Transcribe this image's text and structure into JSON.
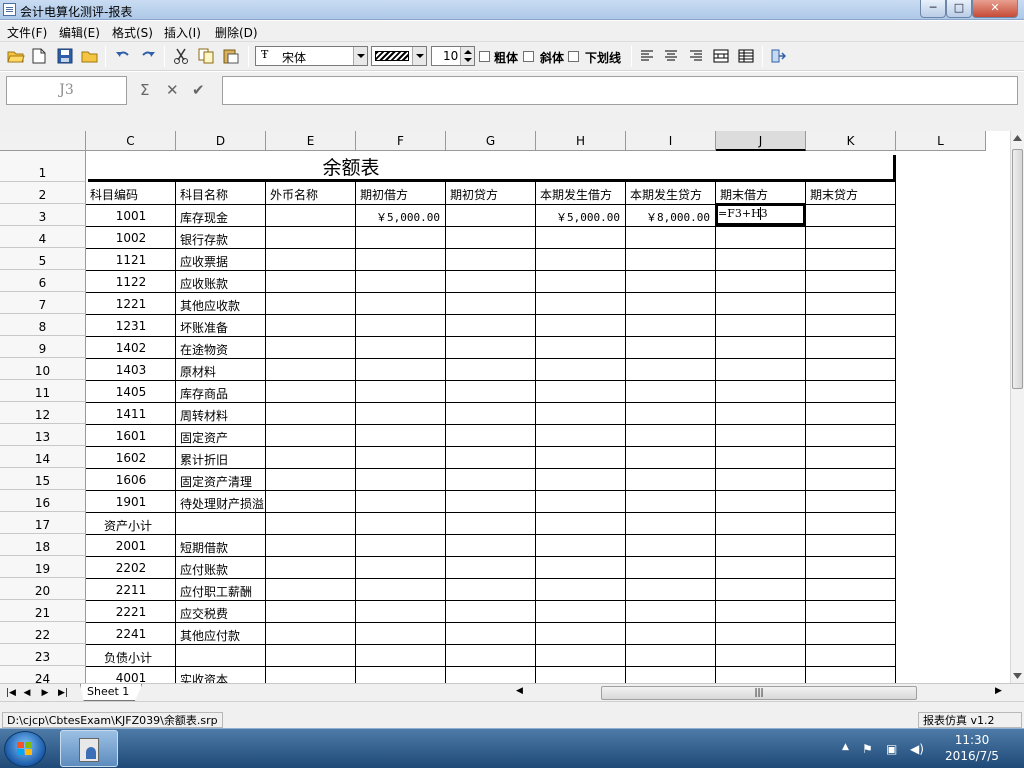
{
  "window": {
    "title": "会计电算化测评-报表",
    "min_label": "─",
    "max_label": "□",
    "close_label": "✕"
  },
  "menu": [
    "文件(F)",
    "编辑(E)",
    "格式(S)",
    "插入(I)",
    "删除(D)"
  ],
  "toolbar": {
    "font_name": "宋体",
    "font_size": "10",
    "bold_label": "粗体",
    "italic_label": "斜体",
    "underline_label": "下划线"
  },
  "formula_bar": {
    "cell_ref": "J3",
    "sum_symbol": "Σ",
    "cancel_symbol": "✕",
    "confirm_symbol": "✔",
    "formula": ""
  },
  "columns": [
    {
      "label": "C"
    },
    {
      "label": "D"
    },
    {
      "label": "E"
    },
    {
      "label": "F"
    },
    {
      "label": "G"
    },
    {
      "label": "H"
    },
    {
      "label": "I"
    },
    {
      "label": "J"
    },
    {
      "label": "K"
    },
    {
      "label": "L"
    }
  ],
  "active_column": "J",
  "active_cell": "J3",
  "sheet": {
    "title": "余额表",
    "headers": [
      "科目编码",
      "科目名称",
      "外币名称",
      "期初借方",
      "期初贷方",
      "本期发生借方",
      "本期发生贷方",
      "期末借方",
      "期末贷方"
    ],
    "rows": [
      {
        "num": "3",
        "code": "1001",
        "name": "库存现金",
        "values": [
          "",
          "￥5,000.00",
          "",
          "￥5,000.00",
          "￥8,000.00",
          "=F3+H3",
          ""
        ]
      },
      {
        "num": "4",
        "code": "1002",
        "name": "银行存款"
      },
      {
        "num": "5",
        "code": "1121",
        "name": "应收票据"
      },
      {
        "num": "6",
        "code": "1122",
        "name": "应收账款"
      },
      {
        "num": "7",
        "code": "1221",
        "name": "其他应收款"
      },
      {
        "num": "8",
        "code": "1231",
        "name": "坏账准备"
      },
      {
        "num": "9",
        "code": "1402",
        "name": "在途物资"
      },
      {
        "num": "10",
        "code": "1403",
        "name": "原材料"
      },
      {
        "num": "11",
        "code": "1405",
        "name": "库存商品"
      },
      {
        "num": "12",
        "code": "1411",
        "name": "周转材料"
      },
      {
        "num": "13",
        "code": "1601",
        "name": "固定资产"
      },
      {
        "num": "14",
        "code": "1602",
        "name": "累计折旧"
      },
      {
        "num": "15",
        "code": "1606",
        "name": "固定资产清理"
      },
      {
        "num": "16",
        "code": "1901",
        "name": "待处理财产损溢"
      },
      {
        "num": "17",
        "code": "资产小计",
        "name": "",
        "subtotal": true
      },
      {
        "num": "18",
        "code": "2001",
        "name": "短期借款"
      },
      {
        "num": "19",
        "code": "2202",
        "name": "应付账款"
      },
      {
        "num": "20",
        "code": "2211",
        "name": "应付职工薪酬"
      },
      {
        "num": "21",
        "code": "2221",
        "name": "应交税费"
      },
      {
        "num": "22",
        "code": "2241",
        "name": "其他应付款"
      },
      {
        "num": "23",
        "code": "负债小计",
        "name": "",
        "subtotal": true
      },
      {
        "num": "24",
        "code": "4001",
        "name": "实收资本"
      }
    ]
  },
  "sheet_tabs": [
    "Sheet 1"
  ],
  "status": {
    "path": "D:\\cjcp\\CbtesExam\\KJFZ039\\余额表.srp",
    "app": "报表仿真 v1.2"
  },
  "taskbar": {
    "time": "11:30",
    "date": "2016/7/5"
  }
}
